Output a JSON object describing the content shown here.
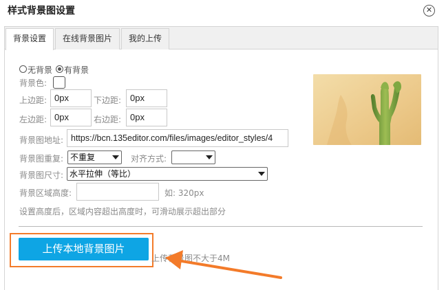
{
  "dialog": {
    "title": "样式背景图设置",
    "close_label": "✕"
  },
  "tabs": [
    {
      "label": "背景设置",
      "active": true
    },
    {
      "label": "在线背景图片",
      "active": false
    },
    {
      "label": "我的上传",
      "active": false
    }
  ],
  "bg_mode": {
    "option_none": "无背景",
    "option_has": "有背景",
    "selected": "有背景"
  },
  "bg_color": {
    "label": "背景色:"
  },
  "padding": {
    "top_label": "上边距:",
    "top_value": "0px",
    "bottom_label": "下边距:",
    "bottom_value": "0px",
    "left_label": "左边距:",
    "left_value": "0px",
    "right_label": "右边距:",
    "right_value": "0px"
  },
  "image_url": {
    "label": "背景图地址:",
    "value": "https://bcn.135editor.com/files/images/editor_styles/4"
  },
  "repeat": {
    "label": "背景图重复:",
    "value": "不重复"
  },
  "align": {
    "label": "对齐方式:",
    "value": ""
  },
  "size": {
    "label": "背景图尺寸:",
    "value": "水平拉伸（等比）"
  },
  "area_height": {
    "label": "背景区域高度:",
    "value": "",
    "example": "如: 320px"
  },
  "hint_text": "设置高度后，区域内容超出高度时，可滑动展示超出部分",
  "upload": {
    "button_label": "上传本地背景图片",
    "hint": "上传背景图不大于4M"
  },
  "colors": {
    "accent_blue": "#0ea5e4",
    "annotation_orange": "#f37b2a"
  }
}
